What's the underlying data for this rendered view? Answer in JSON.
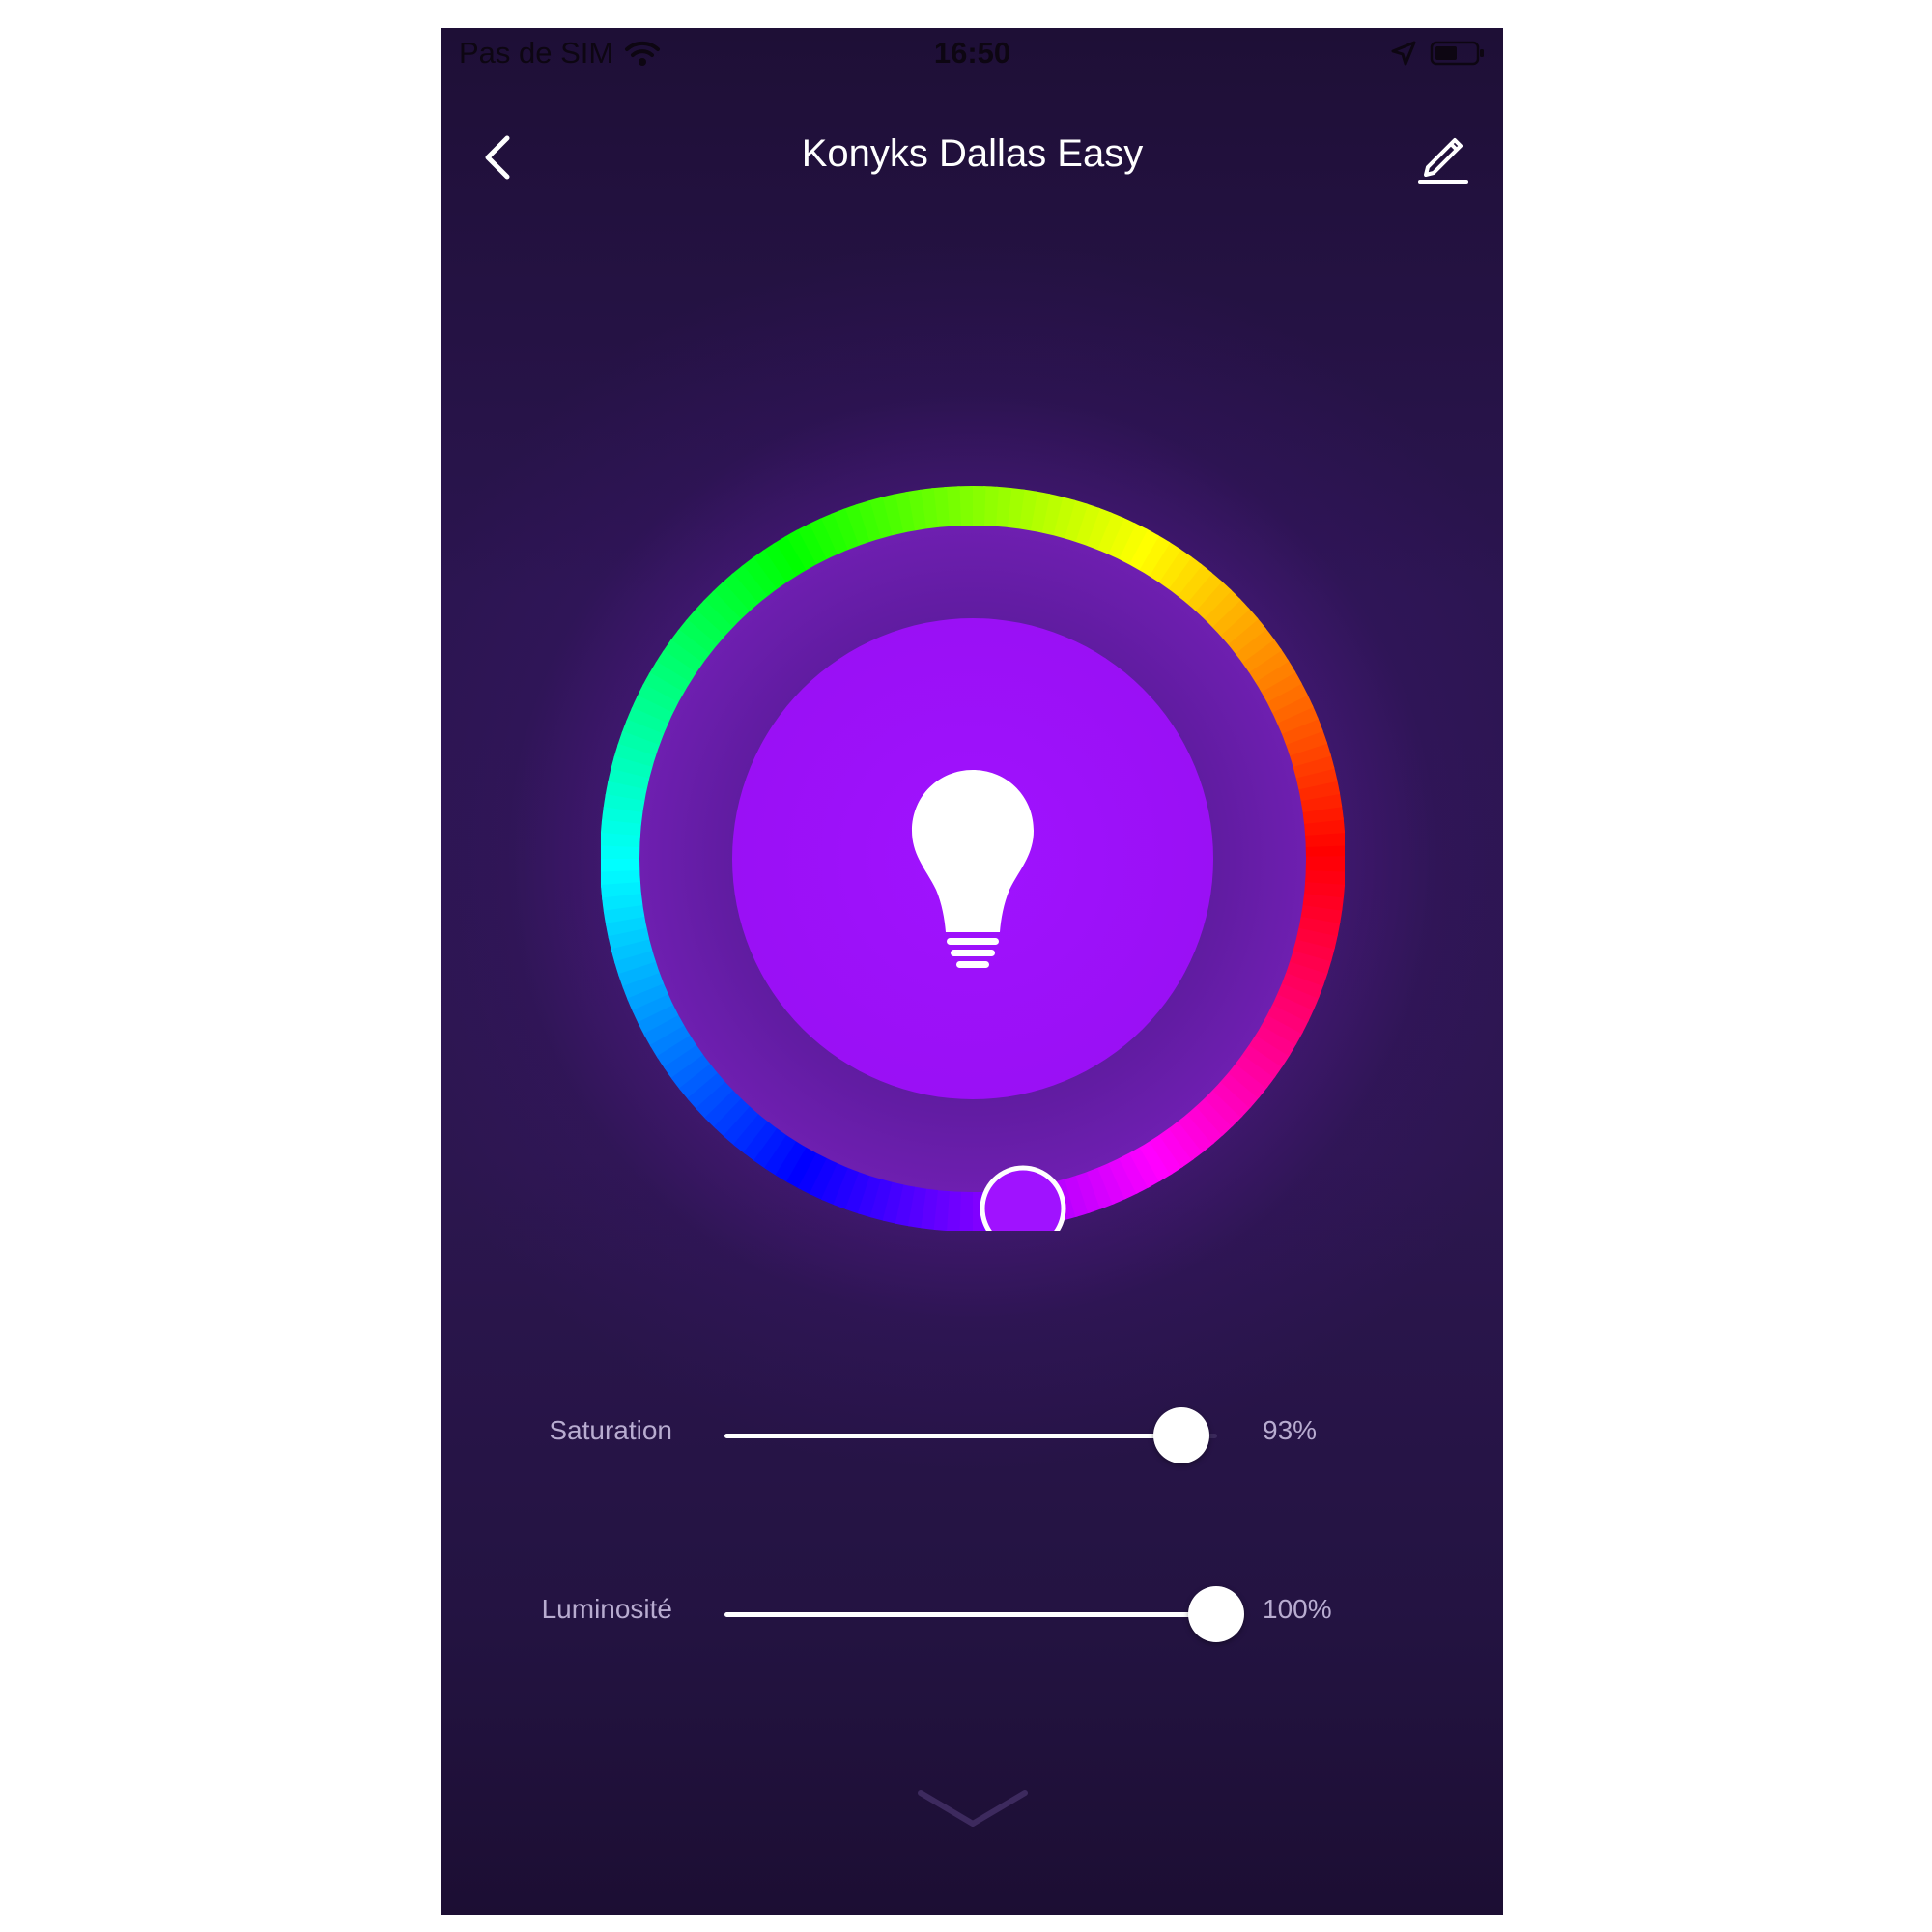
{
  "status_bar": {
    "carrier": "Pas de SIM",
    "time": "16:50",
    "wifi_icon": "wifi-icon",
    "location_icon": "location-arrow-icon",
    "battery_icon": "battery-icon"
  },
  "header": {
    "title": "Konyks Dallas Easy",
    "back_icon": "chevron-left-icon",
    "edit_icon": "pencil-icon"
  },
  "color_wheel": {
    "selected_color": "#a012ff",
    "center_icon": "lightbulb-icon"
  },
  "sliders": [
    {
      "label": "Saturation",
      "value": "93%",
      "level": 0.93
    },
    {
      "label": "Luminosité",
      "value": "100%",
      "level": 1.0
    }
  ],
  "footer": {
    "expand_icon": "chevron-down-icon"
  },
  "colors": {
    "background_top": "#1e0f36",
    "background_mid": "#2c164f",
    "accent": "#a012ff",
    "text_muted": "#b8acd0"
  }
}
